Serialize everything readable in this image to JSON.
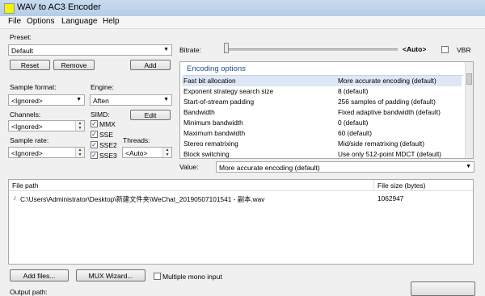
{
  "window": {
    "title": "WAV to AC3 Encoder"
  },
  "menu": [
    "File",
    "Options",
    "Language",
    "Help"
  ],
  "preset": {
    "label": "Preset:",
    "value": "Default",
    "reset_label": "Reset",
    "remove_label": "Remove",
    "add_label": "Add"
  },
  "bitrate": {
    "label": "Bitrate:",
    "value": "<Auto>",
    "vbr_label": "VBR"
  },
  "sample_format": {
    "label": "Sample format:",
    "value": "<Ignored>"
  },
  "engine": {
    "label": "Engine:",
    "value": "Aften"
  },
  "channels": {
    "label": "Channels:",
    "value": "<Ignored>"
  },
  "simd": {
    "label": "SIMD:",
    "edit_label": "Edit",
    "options": [
      {
        "label": "MMX",
        "checked": true
      },
      {
        "label": "SSE",
        "checked": true
      },
      {
        "label": "SSE2",
        "checked": true
      },
      {
        "label": "SSE3",
        "checked": true
      }
    ]
  },
  "sample_rate": {
    "label": "Sample rate:",
    "value": "<Ignored>"
  },
  "threads": {
    "label": "Threads:",
    "value": "<Auto>"
  },
  "encoding_options": {
    "header": "Encoding options",
    "rows": [
      {
        "key": "Fast bit allocation",
        "value": "More accurate encoding (default)",
        "selected": true
      },
      {
        "key": "Exponent strategy search size",
        "value": "8 (default)"
      },
      {
        "key": "Start-of-stream padding",
        "value": "256 samples of padding (default)"
      },
      {
        "key": "Bandwidth",
        "value": "Fixed adaptive bandwidth (default)"
      },
      {
        "key": "Minimum bandwidth",
        "value": "0 (default)"
      },
      {
        "key": "Maximum bandwidth",
        "value": "60 (default)"
      },
      {
        "key": "Stereo rematrixing",
        "value": "Mid/side rematrixing (default)"
      },
      {
        "key": "Block switching",
        "value": "Use only 512-point MDCT (default)"
      }
    ]
  },
  "value_select": {
    "label": "Value:",
    "value": "More accurate encoding (default)"
  },
  "files": {
    "columns": [
      "File path",
      "File size (bytes)"
    ],
    "rows": [
      {
        "path": "C:\\Users\\Administrator\\Desktop\\新建文件夹\\WeChat_20190507101541 - 副本.wav",
        "size": "1062947"
      }
    ]
  },
  "bottom": {
    "add_files_label": "Add files...",
    "mux_label": "MUX Wizard...",
    "multiple_mono_label": "Multiple mono input",
    "output_label": "Output path:"
  }
}
